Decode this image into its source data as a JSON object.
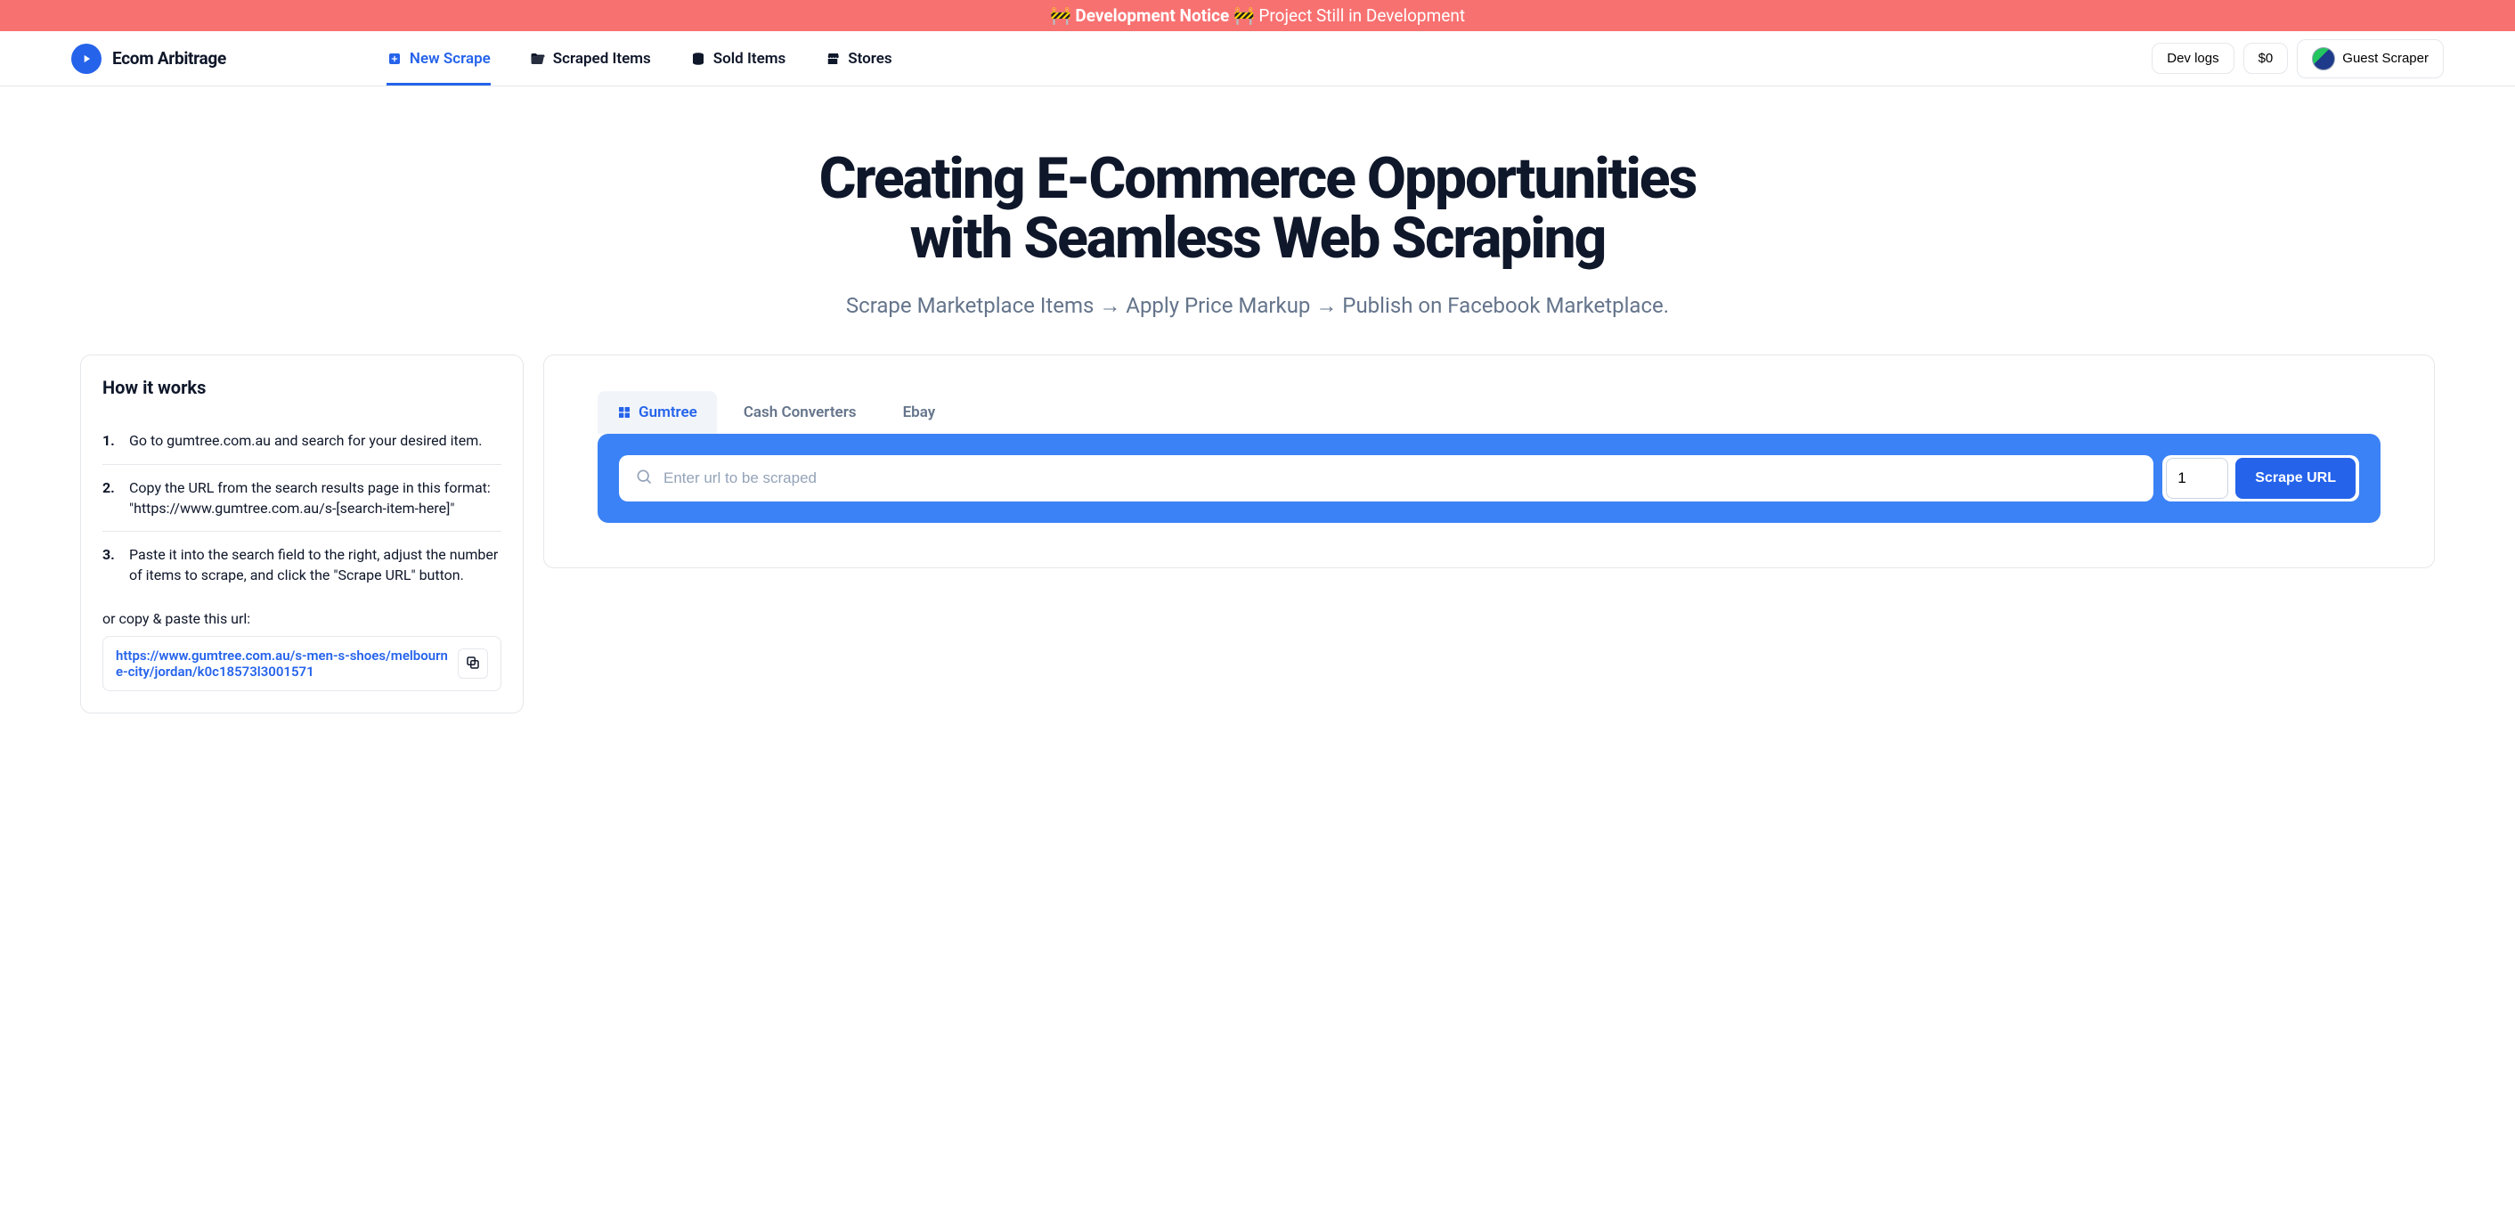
{
  "banner": {
    "prefix": "🚧",
    "title": "Development Notice",
    "suffix": "🚧",
    "message": "Project Still in Development"
  },
  "header": {
    "logo_title": "Ecom Arbitrage",
    "nav": [
      {
        "label": "New Scrape",
        "active": true
      },
      {
        "label": "Scraped Items",
        "active": false
      },
      {
        "label": "Sold Items",
        "active": false
      },
      {
        "label": "Stores",
        "active": false
      }
    ],
    "dev_logs": "Dev logs",
    "balance": "$0",
    "user_name": "Guest Scraper"
  },
  "hero": {
    "title_line1": "Creating E-Commerce Opportunities",
    "title_line2": "with Seamless Web Scraping",
    "subtitle": "Scrape Marketplace Items → Apply Price Markup → Publish on Facebook Marketplace."
  },
  "how": {
    "heading": "How it works",
    "steps": [
      "Go to gumtree.com.au and search for your desired item.",
      "Copy the URL from the search results page in this format: \"https://www.gumtree.com.au/s-[search-item-here]\"",
      "Paste it into the search field to the right, adjust the number of items to scrape, and click the \"Scrape URL\" button."
    ],
    "copy_label": "or copy & paste this url:",
    "example_url": "https://www.gumtree.com.au/s-men-s-shoes/melbourne-city/jordan/k0c18573l3001571"
  },
  "scrape": {
    "tabs": [
      {
        "label": "Gumtree",
        "active": true
      },
      {
        "label": "Cash Converters",
        "active": false
      },
      {
        "label": "Ebay",
        "active": false
      }
    ],
    "url_placeholder": "Enter url to be scraped",
    "count_value": "1",
    "button": "Scrape URL"
  }
}
